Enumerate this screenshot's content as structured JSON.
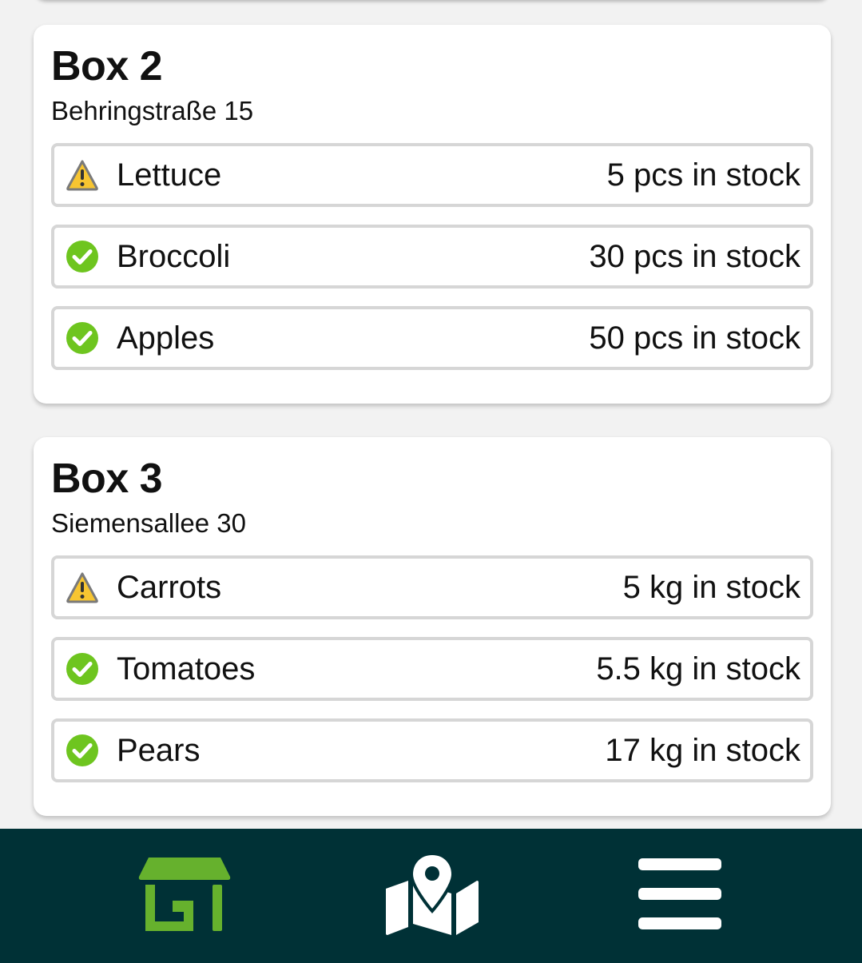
{
  "colors": {
    "header_bg": "#003136",
    "accent_green": "#66b12d",
    "warning_yellow": "#f7c531",
    "ok_green": "#6ec51f",
    "card_bg": "#ffffff",
    "page_bg": "#f2f2f2"
  },
  "boxes": [
    {
      "title": "Box 2",
      "address": "Behringstraße 15",
      "items": [
        {
          "status_icon": "warning-icon",
          "name": "Lettuce",
          "stock": "5 pcs in stock"
        },
        {
          "status_icon": "check-circle-icon",
          "name": "Broccoli",
          "stock": "30 pcs in stock"
        },
        {
          "status_icon": "check-circle-icon",
          "name": "Apples",
          "stock": "50 pcs in stock"
        }
      ]
    },
    {
      "title": "Box 3",
      "address": "Siemensallee 30",
      "items": [
        {
          "status_icon": "warning-icon",
          "name": "Carrots",
          "stock": "5 kg in stock"
        },
        {
          "status_icon": "check-circle-icon",
          "name": "Tomatoes",
          "stock": "5.5 kg in stock"
        },
        {
          "status_icon": "check-circle-icon",
          "name": "Pears",
          "stock": "17 kg in stock"
        }
      ]
    }
  ],
  "bottom_nav": {
    "items": [
      {
        "icon": "shop-icon",
        "active": true
      },
      {
        "icon": "map-icon",
        "active": false
      },
      {
        "icon": "menu-icon",
        "active": false
      }
    ]
  }
}
